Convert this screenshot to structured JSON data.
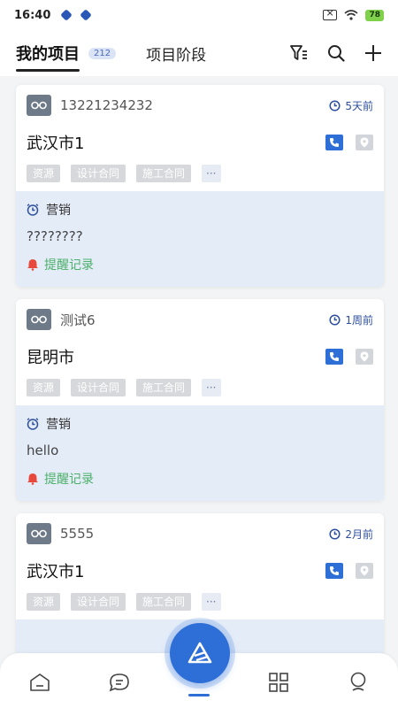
{
  "status_bar": {
    "time": "16:40",
    "battery": "78"
  },
  "header": {
    "active_tab": "我的项目",
    "count": "212",
    "other_tab": "项目阶段",
    "icons": [
      "filter-icon",
      "search-icon",
      "add-icon"
    ]
  },
  "cards": [
    {
      "account": "13221234232",
      "time": "5天前",
      "title": "武汉市1",
      "tags": [
        "资源",
        "设计合同",
        "施工合同"
      ],
      "more": "···",
      "follow_type": "营销",
      "follow_content": "????????",
      "remind": "提醒记录"
    },
    {
      "account": "测试6",
      "time": "1周前",
      "title": "昆明市",
      "tags": [
        "资源",
        "设计合同",
        "施工合同"
      ],
      "more": "···",
      "follow_type": "营销",
      "follow_content": "hello",
      "remind": "提醒记录"
    },
    {
      "account": "5555",
      "time": "2月前",
      "title": "武汉市1",
      "tags": [
        "资源",
        "设计合同",
        "施工合同"
      ],
      "more": "···"
    }
  ],
  "colors": {
    "accent": "#2e6fd7",
    "remind": "#4db06a",
    "bell": "#e8483b"
  }
}
